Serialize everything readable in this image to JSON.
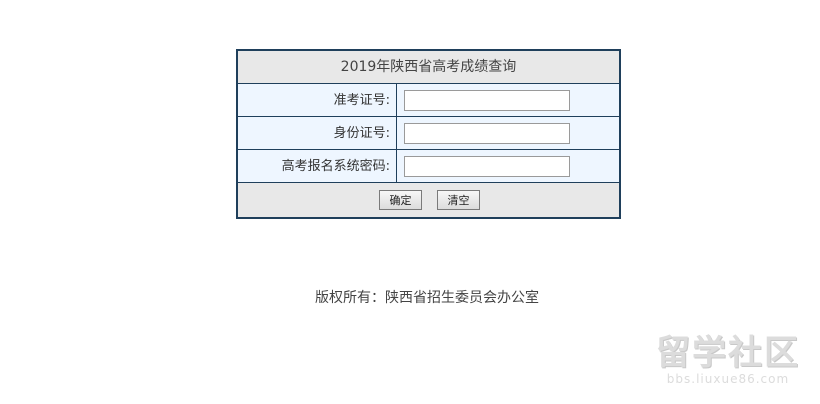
{
  "form": {
    "title": "2019年陕西省高考成绩查询",
    "fields": [
      {
        "label": "准考证号:",
        "value": ""
      },
      {
        "label": "身份证号:",
        "value": ""
      },
      {
        "label": "高考报名系统密码:",
        "value": ""
      }
    ],
    "buttons": {
      "confirm": "确定",
      "clear": "清空"
    }
  },
  "footer": {
    "copyright": "版权所有：陕西省招生委员会办公室"
  },
  "watermark": {
    "name": "留学社区",
    "url": "bbs.liuxue86.com"
  }
}
